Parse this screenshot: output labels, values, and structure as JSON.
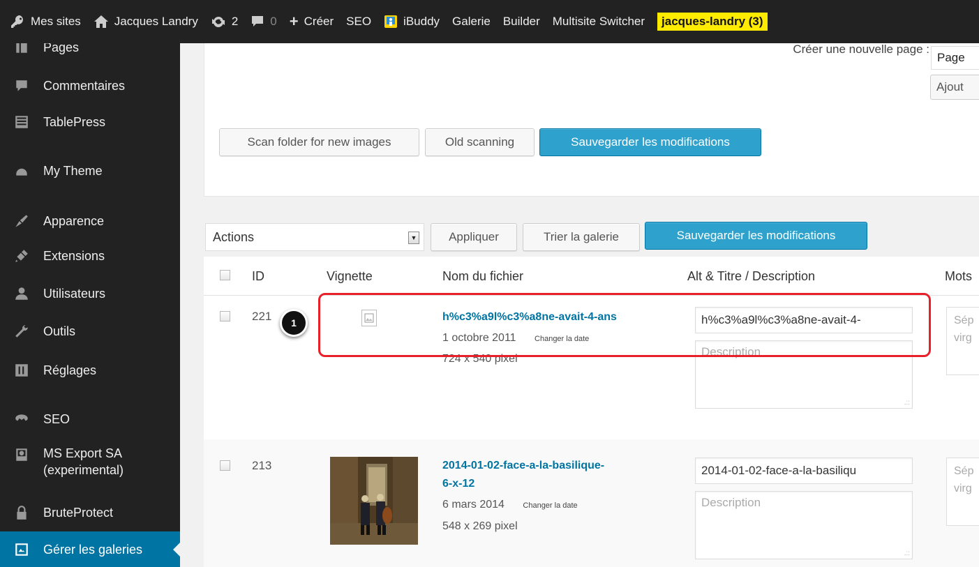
{
  "adminbar": {
    "my_sites": "Mes sites",
    "site_name": "Jacques Landry",
    "updates_count": "2",
    "comments_count": "0",
    "create": "Créer",
    "seo": "SEO",
    "ibuddy": "iBuddy",
    "gallery": "Galerie",
    "builder": "Builder",
    "multisite": "Multisite Switcher",
    "user": "jacques-landry (3)"
  },
  "sidebar": {
    "items": [
      {
        "label": "Pages",
        "icon": "pages-icon"
      },
      {
        "label": "Commentaires",
        "icon": "comment-icon"
      },
      {
        "label": "TablePress",
        "icon": "table-icon"
      },
      {
        "label": "My Theme",
        "icon": "helmet-icon"
      },
      {
        "label": "Apparence",
        "icon": "brush-icon"
      },
      {
        "label": "Extensions",
        "icon": "plug-icon"
      },
      {
        "label": "Utilisateurs",
        "icon": "user-icon"
      },
      {
        "label": "Outils",
        "icon": "wrench-icon"
      },
      {
        "label": "Réglages",
        "icon": "settings-icon"
      },
      {
        "label": "SEO",
        "icon": "seo-icon"
      },
      {
        "label": "MS Export SA",
        "label2": "(experimental)",
        "icon": "export-icon"
      },
      {
        "label": "BruteProtect",
        "icon": "lock-icon"
      },
      {
        "label": "Gérer les galeries",
        "icon": "gallery-icon"
      }
    ]
  },
  "new_page": {
    "label": "Créer une nouvelle page :",
    "select_value": "Page",
    "add_button": "Ajout"
  },
  "toolbar_top": {
    "scan": "Scan folder for new images",
    "old_scan": "Old scanning",
    "save": "Sauvegarder les modifications"
  },
  "toolbar_bulk": {
    "actions": "Actions",
    "apply": "Appliquer",
    "sort": "Trier la galerie",
    "save": "Sauvegarder les modifications"
  },
  "table": {
    "headers": {
      "id": "ID",
      "thumb": "Vignette",
      "filename": "Nom du fichier",
      "alt": "Alt & Titre / Description",
      "tags": "Mots"
    },
    "rows": [
      {
        "id": "221",
        "filename": "h%c3%a9l%c3%a8ne-avait-4-ans",
        "date": "1 octobre 2011",
        "change_date": "Changer la date",
        "dimensions": "724 x 540 pixel",
        "alt": "h%c3%a9l%c3%a8ne-avait-4-",
        "description_placeholder": "Description",
        "tags_placeholder_1": "Sép",
        "tags_placeholder_2": "virg"
      },
      {
        "id": "213",
        "filename_1": "2014-01-02-face-a-la-basilique-",
        "filename_2": "6-x-12",
        "date": "6 mars 2014",
        "change_date": "Changer la date",
        "dimensions": "548 x 269 pixel",
        "alt": "2014-01-02-face-a-la-basiliqu",
        "description_placeholder": "Description",
        "tags_placeholder_1": "Sép",
        "tags_placeholder_2": "virg"
      }
    ]
  },
  "callout": {
    "number": "1"
  },
  "colors": {
    "accent": "#0074a2",
    "button_primary": "#2ea2cc",
    "highlight": "#e8202a",
    "user_badge": "#ffeb00"
  }
}
